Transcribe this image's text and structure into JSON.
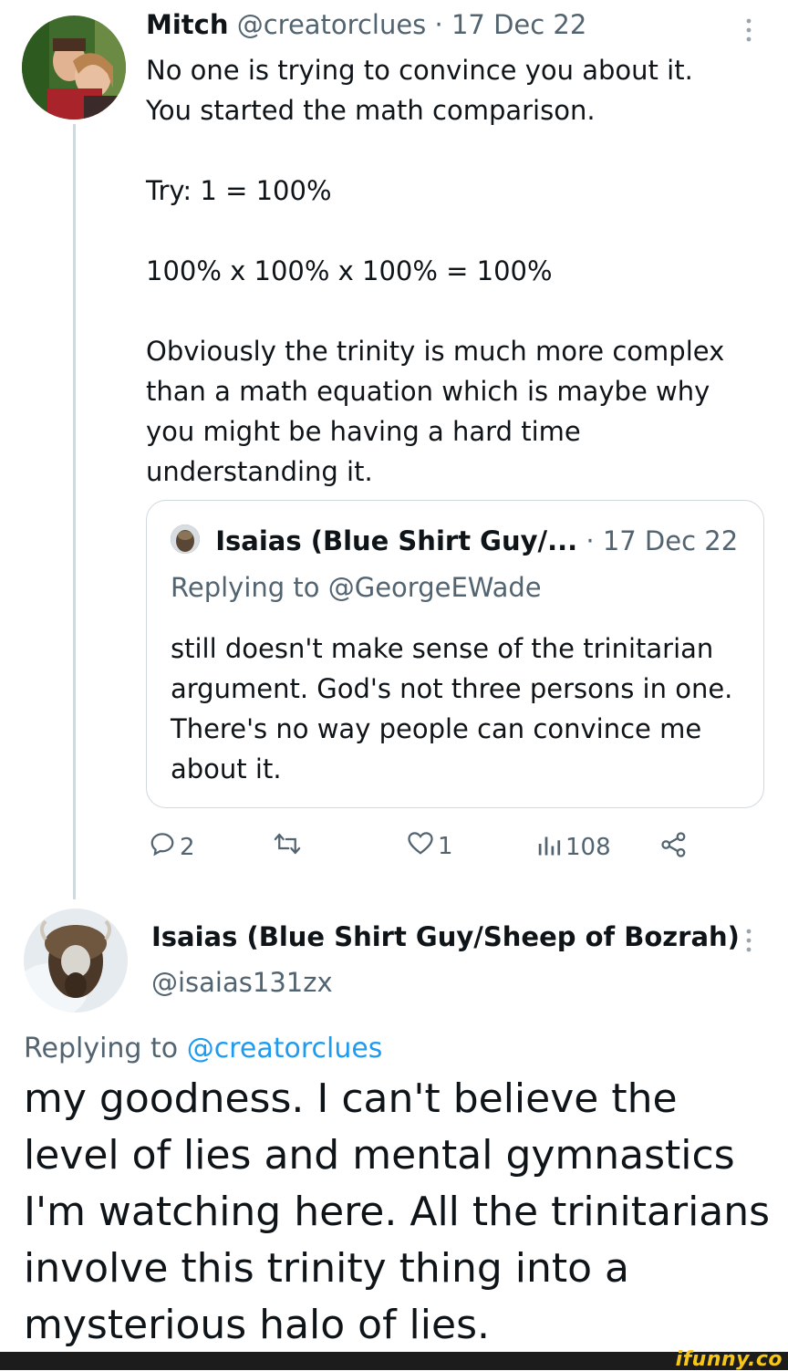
{
  "tweet1": {
    "display_name": "Mitch",
    "handle": "@creatorclues",
    "separator": "·",
    "date": "17 Dec 22",
    "text": "No one is trying to convince you about it.\nYou started the math comparison.\n\nTry: 1 = 100%\n\n100% x 100% x 100% = 100%\n\nObviously the trinity is much more complex than a math equation which is maybe why you might be having a hard time understanding it.",
    "quoted": {
      "display_name": "Isaias (Blue Shirt Guy/...",
      "separator": "·",
      "date": "17 Dec 22",
      "replying_prefix": "Replying to",
      "replying_handle": "@GeorgeEWade",
      "text": "still doesn't make sense of the trinitarian argument. God's not three persons in one. There's no way people can convince me about it."
    },
    "actions": {
      "replies": "2",
      "retweets": "",
      "likes": "1",
      "views": "108"
    }
  },
  "tweet2": {
    "display_name": "Isaias (Blue Shirt Guy/Sheep of Bozrah)",
    "handle": "@isaias131zx",
    "replying_prefix": "Replying to",
    "replying_handle": "@creatorclues",
    "text": "my goodness. I can't believe the level of lies and mental gymnastics I'm watching here. All the trinitarians involve this trinity thing into a mysterious halo of lies."
  },
  "watermark": "ifunny.co",
  "colors": {
    "text": "#0f1419",
    "muted": "#536471",
    "link": "#1d9bf0",
    "border": "#cfd9de",
    "watermark": "#f6c718"
  },
  "icons": [
    "reply-icon",
    "retweet-icon",
    "like-icon",
    "views-icon",
    "share-icon",
    "more-icon"
  ]
}
